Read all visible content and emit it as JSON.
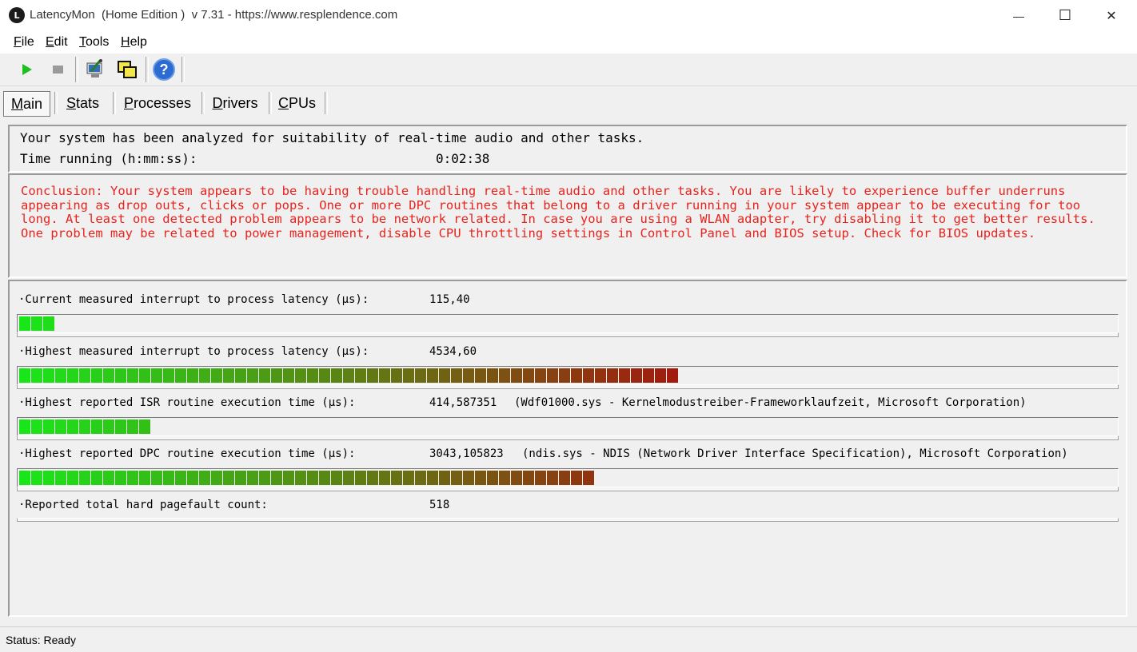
{
  "window": {
    "title": "LatencyMon  (Home Edition )  v 7.31 - https://www.resplendence.com",
    "app_icon_glyph": "L",
    "minimize_glyph": "—",
    "maximize_glyph": "☐",
    "close_glyph": "✕"
  },
  "menu": [
    {
      "acc": "F",
      "rest": "ile"
    },
    {
      "acc": "E",
      "rest": "dit"
    },
    {
      "acc": "T",
      "rest": "ools"
    },
    {
      "acc": "H",
      "rest": "elp"
    }
  ],
  "toolbar": {
    "buttons": [
      "play-icon",
      "stop-icon",
      "inspect-icon",
      "windows-icon",
      "help-icon"
    ],
    "help_glyph": "?"
  },
  "tabs": [
    {
      "acc": "M",
      "rest": "ain",
      "active": true
    },
    {
      "acc": "S",
      "rest": "tats"
    },
    {
      "acc": "P",
      "rest": "rocesses"
    },
    {
      "acc": "D",
      "rest": "rivers"
    },
    {
      "acc": "C",
      "rest": "PUs"
    }
  ],
  "summary": {
    "line1": "Your system has been analyzed for suitability of real-time audio and other tasks.",
    "time_label": "Time running (h:mm:ss):",
    "time_value": "0:02:38"
  },
  "conclusion": {
    "text": "Conclusion: Your system appears to be having trouble handling real-time audio and other tasks. You are likely to experience buffer underruns appearing as drop outs, clicks or pops. One or more DPC routines that belong to a driver running in your system appear to be executing for too long. At least one detected problem appears to be network related. In case you are using a WLAN adapter, try disabling it to get better results. One problem may be related to power management, disable CPU throttling settings in Control Panel and BIOS setup. Check for BIOS updates.",
    "color": "#e8231d"
  },
  "metrics": [
    {
      "label": "·Current measured interrupt to process latency (µs):",
      "value": "115,40",
      "detail": "",
      "blocks": 3
    },
    {
      "label": "·Highest measured interrupt to process latency (µs):",
      "value": "4534,60",
      "detail": "",
      "blocks": 55
    },
    {
      "label": "·Highest reported ISR routine execution time (µs):",
      "value": "414,587351",
      "detail": "(Wdf01000.sys - Kernelmodustreiber-Frameworklaufzeit, Microsoft Corporation)",
      "blocks": 11
    },
    {
      "label": "·Highest reported DPC routine execution time (µs):",
      "value": "3043,105823",
      "detail": "(ndis.sys - NDIS (Network Driver Interface Specification), Microsoft Corporation)",
      "blocks": 48
    },
    {
      "label": "·Reported total hard pagefault count:",
      "value": "518",
      "detail": "",
      "blocks": 0
    }
  ],
  "bar_colors": {
    "low": "#19e619",
    "high": "#a11b0e"
  },
  "status": {
    "text": "Status: Ready"
  }
}
